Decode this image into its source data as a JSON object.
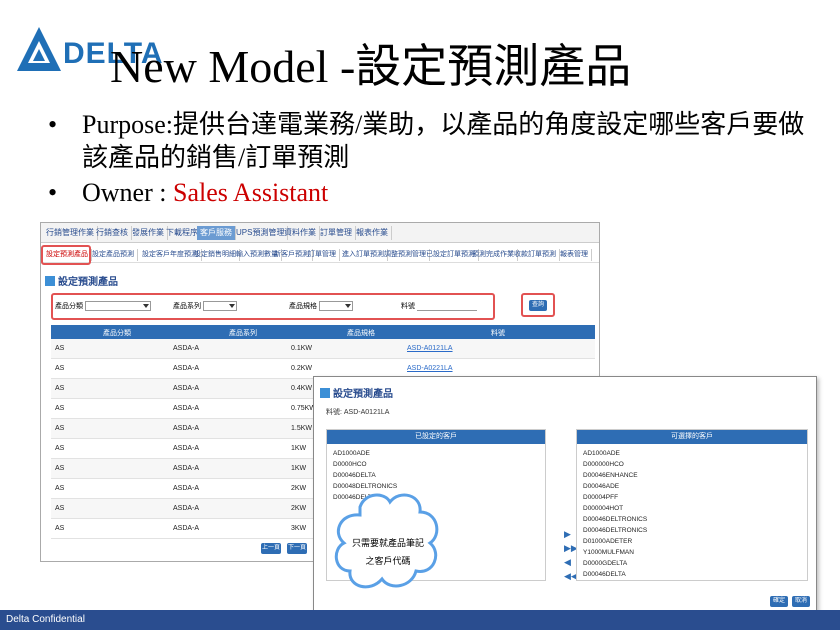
{
  "brand": {
    "logo_text": "DELTA",
    "logo_color": "#1f6fb6"
  },
  "title": "New Model -設定預測產品",
  "bullets": [
    {
      "label": "Purpose:",
      "text": "提供台達電業務/業助，以產品的角度設定哪些客戶要做該產品的銷售/訂單預測"
    },
    {
      "label": "Owner :",
      "accent_text": "Sales Assistant"
    }
  ],
  "footer": {
    "text": "Delta Confidential",
    "color": "#2a4d8f"
  },
  "screenshot_main": {
    "top_tabs": [
      "行銷管理作業",
      "行銷查核",
      "發展作業",
      "下載程序",
      "客戶服務",
      "UPS預測管理",
      "資料作業",
      "訂單管理",
      "報表作業"
    ],
    "active_tab": "客戶服務",
    "sub_tabs": [
      "設定預測產品",
      "設定產品預測",
      "設定客戶年度預測",
      "設定銷售明細",
      "輸入預測數量",
      "新客戶預測",
      "訂單管理",
      "進入訂單預測",
      "調整預測管理",
      "已設定訂單預測",
      "預測完成作業",
      "收款訂單預測",
      "報表管理"
    ],
    "selected_sub": "設定預測產品",
    "page_title": "設定預測產品",
    "filters": [
      {
        "label": "產品分類",
        "kind": "select"
      },
      {
        "label": "產品系列",
        "kind": "select"
      },
      {
        "label": "產品規格",
        "kind": "select"
      },
      {
        "label": "料號",
        "kind": "text"
      }
    ],
    "query_button": "查詢",
    "columns": [
      "產品分類",
      "產品系列",
      "產品規格",
      "料號"
    ],
    "rows": [
      {
        "cat": "AS",
        "series": "ASDA-A",
        "spec": "0.1KW",
        "part": "ASD-A0121LA"
      },
      {
        "cat": "AS",
        "series": "ASDA-A",
        "spec": "0.2KW",
        "part": "ASD-A0221LA"
      },
      {
        "cat": "AS",
        "series": "ASDA-A",
        "spec": "0.4KW",
        "part": ""
      },
      {
        "cat": "AS",
        "series": "ASDA-A",
        "spec": "0.75KW",
        "part": ""
      },
      {
        "cat": "AS",
        "series": "ASDA-A",
        "spec": "1.5KW",
        "part": ""
      },
      {
        "cat": "AS",
        "series": "ASDA-A",
        "spec": "1KW",
        "part": ""
      },
      {
        "cat": "AS",
        "series": "ASDA-A",
        "spec": "1KW",
        "part": ""
      },
      {
        "cat": "AS",
        "series": "ASDA-A",
        "spec": "2KW",
        "part": ""
      },
      {
        "cat": "AS",
        "series": "ASDA-A",
        "spec": "2KW",
        "part": ""
      },
      {
        "cat": "AS",
        "series": "ASDA-A",
        "spec": "3KW",
        "part": ""
      }
    ],
    "bottom_buttons": [
      "上一頁",
      "下一頁"
    ]
  },
  "screenshot_popup": {
    "page_title": "設定預測產品",
    "model_label": "料號: ASD-A0121LA",
    "left_panel": {
      "title": "已設定的客戶",
      "items": [
        "AD1000ADE",
        "D0000HCO",
        "D00046DELTA",
        "D00048DELTRONICS",
        "D00046DELTA"
      ]
    },
    "right_panel": {
      "title": "可選擇的客戶",
      "items": [
        "AD1000ADE",
        "D000000HCO",
        "D00046ENHANCE",
        "D00046ADE",
        "D00004PFF",
        "D000004HOT",
        "D00046DELTRONICS",
        "D00046DELTRONICS",
        "D01000ADETER",
        "Y1000MULFMAN",
        "D0000GDELTA",
        "D00046DELTA"
      ]
    },
    "arrows": [
      "▶",
      "▶▶",
      "◀",
      "◀◀"
    ],
    "buttons": [
      "確定",
      "取消"
    ]
  },
  "callout": {
    "line1": "只需要就產品筆記",
    "line2": "之客戶代碼"
  }
}
